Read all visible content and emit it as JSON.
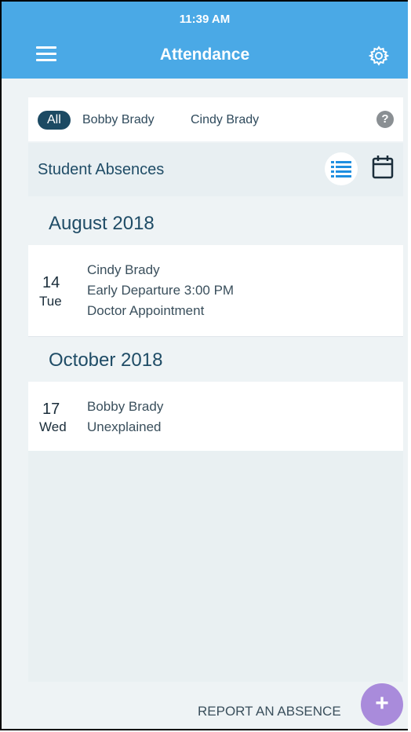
{
  "status_bar": {
    "time": "11:39 AM"
  },
  "header": {
    "title": "Attendance",
    "menu_icon": "hamburger-menu-icon",
    "settings_icon": "gear-icon"
  },
  "filters": {
    "items": [
      {
        "label": "All",
        "active": true
      },
      {
        "label": "Bobby Brady",
        "active": false
      },
      {
        "label": "Cindy Brady",
        "active": false
      }
    ],
    "help_icon": "question-circle-icon"
  },
  "section": {
    "title": "Student Absences",
    "list_view_icon": "list-icon",
    "calendar_view_icon": "calendar-icon"
  },
  "months": [
    {
      "label": "August 2018",
      "entries": [
        {
          "day_num": "14",
          "day_name": "Tue",
          "lines": [
            "Cindy Brady",
            "Early Departure 3:00 PM",
            "Doctor Appointment"
          ]
        }
      ]
    },
    {
      "label": "October 2018",
      "entries": [
        {
          "day_num": "17",
          "day_name": "Wed",
          "lines": [
            "Bobby Brady",
            "Unexplained"
          ]
        }
      ]
    }
  ],
  "actions": {
    "report_label": "REPORT AN ABSENCE",
    "fab_icon": "plus-icon",
    "fab_symbol": "+"
  },
  "colors": {
    "app_bar": "#4aa9e6",
    "active_chip": "#1c4a63",
    "fab": "#a98bdb",
    "heading_text": "#1f4c66"
  }
}
